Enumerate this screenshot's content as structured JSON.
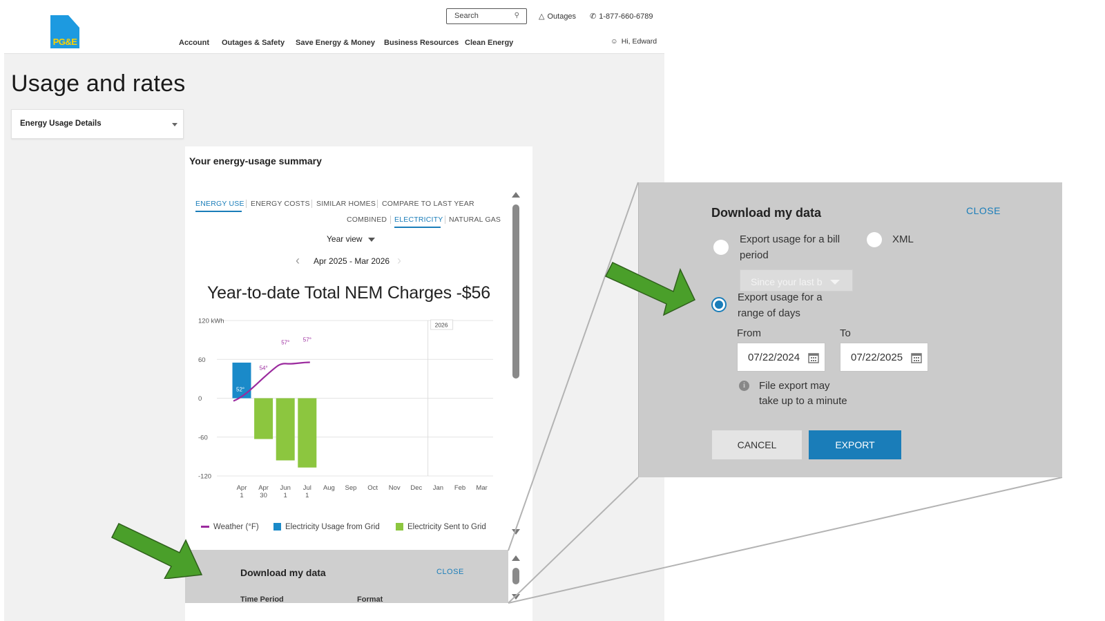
{
  "header": {
    "logo_text": "PG&E",
    "search_placeholder": "Search",
    "outages_label": "Outages",
    "phone": "1-877-660-6789",
    "greeting": "Hi, Edward",
    "nav": [
      "Account",
      "Outages & Safety",
      "Save Energy & Money",
      "Business Resources",
      "Clean Energy"
    ]
  },
  "page": {
    "title": "Usage and rates",
    "dropdown_value": "Energy Usage Details"
  },
  "summary": {
    "title": "Your energy-usage summary",
    "tabs": [
      "ENERGY USE",
      "ENERGY COSTS",
      "SIMILAR HOMES",
      "COMPARE TO LAST YEAR"
    ],
    "active_tab": "ENERGY USE",
    "fuel_tabs": [
      "COMBINED",
      "ELECTRICITY",
      "NATURAL GAS"
    ],
    "active_fuel_tab": "ELECTRICITY",
    "view_select": "Year view",
    "period": "Apr 2025 - Mar 2026",
    "chart_heading": "Year-to-date Total NEM Charges -$56"
  },
  "chart_data": {
    "type": "bar",
    "y_unit_label": "120 kWh",
    "y_ticks": [
      "120 kWh",
      "60",
      "0",
      "-60",
      "-120"
    ],
    "ylim": [
      -120,
      120
    ],
    "year_marker": "2026",
    "categories": [
      [
        "Apr",
        "1"
      ],
      [
        "Apr",
        "30"
      ],
      [
        "Jun",
        "1"
      ],
      [
        "Jul",
        "1"
      ],
      [
        "Aug"
      ],
      [
        "Sep"
      ],
      [
        "Oct"
      ],
      [
        "Nov"
      ],
      [
        "Dec"
      ],
      [
        "Jan"
      ],
      [
        "Feb"
      ],
      [
        "Mar"
      ]
    ],
    "series": [
      {
        "name": "Electricity Usage from Grid",
        "color": "#1a8ac9",
        "values": [
          55,
          0,
          0,
          0,
          0,
          0,
          0,
          0,
          0,
          0,
          0,
          0
        ]
      },
      {
        "name": "Electricity Sent to Grid",
        "color": "#8cc63f",
        "values": [
          0,
          -63,
          -96,
          -107,
          0,
          0,
          0,
          0,
          0,
          0,
          0,
          0
        ]
      },
      {
        "name": "Weather (°F)",
        "color": "#9b2a9e",
        "values": [
          52,
          54,
          57,
          57
        ]
      }
    ],
    "data_labels": [
      "52°",
      "54°",
      "57°",
      "57°"
    ],
    "legend": [
      "Weather (°F)",
      "Electricity Usage from Grid",
      "Electricity Sent to Grid"
    ]
  },
  "download_small": {
    "title": "Download my data",
    "close": "CLOSE",
    "col1": "Time Period",
    "col2": "Format"
  },
  "download_large": {
    "title": "Download my data",
    "close": "CLOSE",
    "option_bill": "Export usage for a bill period",
    "option_xml": "XML",
    "bill_select_placeholder": "Since your last b",
    "option_range": "Export usage for a range of days",
    "from_label": "From",
    "to_label": "To",
    "from_value": "07/22/2024",
    "to_value": "07/22/2025",
    "info_line1": "File export may",
    "info_line2": "take up to a minute",
    "cancel": "CANCEL",
    "export": "EXPORT"
  },
  "colors": {
    "accent": "#1a7db9",
    "arrow": "#4a9f2a",
    "overlay_bg": "#cbcbcb"
  }
}
